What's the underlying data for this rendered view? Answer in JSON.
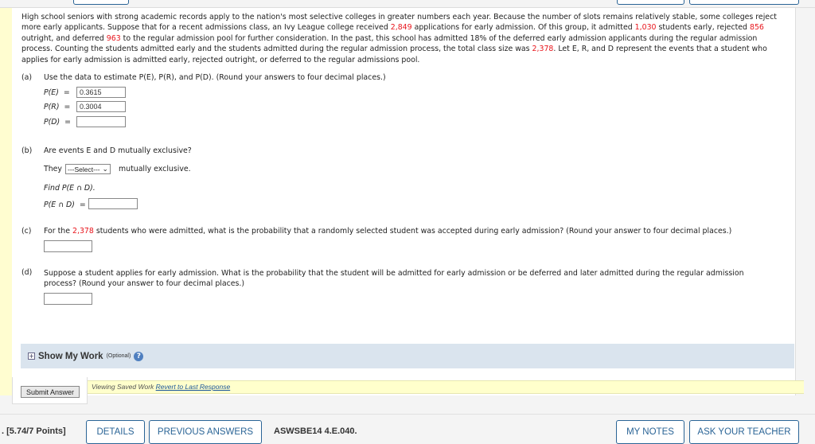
{
  "problem": {
    "t1": "High school seniors with strong academic records apply to the nation's most selective colleges in greater numbers each year. Because the number of slots remains relatively stable, some colleges reject more early applicants. Suppose that for a recent admissions class, an Ivy League college received ",
    "applications": "2,849",
    "t2": " applications for early admission. Of this group, it admitted ",
    "admitted": "1,030",
    "t3": " students early, rejected ",
    "rejected": "856",
    "t4": " outright, and deferred ",
    "deferred": "963",
    "t5": " to the regular admission pool for further consideration. In the past, this school has admitted 18% of the deferred early admission applicants during the regular admission process. Counting the students admitted early and the students admitted during the regular admission process, the total class size was ",
    "class_size": "2,378",
    "t6": ". Let E, R, and D represent the events that a student who applies for early admission is admitted early, rejected outright, or deferred to the regular admissions pool."
  },
  "part_a": {
    "label": "(a)",
    "question": "Use the data to estimate P(E), P(R), and P(D). (Round your answers to four decimal places.)",
    "pe_label": "P(E)  =",
    "pe_value": "0.3615",
    "pr_label": "P(R)  =",
    "pr_value": "0.3004",
    "pd_label": "P(D)  =",
    "pd_value": ""
  },
  "part_b": {
    "label": "(b)",
    "question": "Are events E and D mutually exclusive?",
    "they": "They",
    "select_value": "---Select---",
    "after": "mutually exclusive.",
    "find": "Find P(E ∩ D).",
    "ped_label": "P(E ∩ D)  =",
    "ped_value": ""
  },
  "part_c": {
    "label": "(c)",
    "q1": "For the ",
    "num": "2,378",
    "q2": " students who were admitted, what is the probability that a randomly selected student was accepted during early admission? (Round your answer to four decimal places.)",
    "value": ""
  },
  "part_d": {
    "label": "(d)",
    "question": "Suppose a student applies for early admission. What is the probability that the student will be admitted for early admission or be deferred and later admitted during the regular admission process? (Round your answer to four decimal places.)",
    "value": ""
  },
  "show_my_work": {
    "title": "Show My Work",
    "optional": "(Optional)",
    "help": "?"
  },
  "saved": {
    "text": "Viewing Saved Work ",
    "link": "Revert to Last Response"
  },
  "submit_label": "Submit Answer",
  "bottom": {
    "points": ". [5.74/7 Points]",
    "details": "DETAILS",
    "previous": "PREVIOUS ANSWERS",
    "code": "ASWSBE14 4.E.040.",
    "notes": "MY NOTES",
    "ask": "ASK YOUR TEACHER"
  },
  "colors": {
    "accent": "#2a6496",
    "highlight_number": "#e8141b",
    "yellow": "#fffdd0"
  }
}
